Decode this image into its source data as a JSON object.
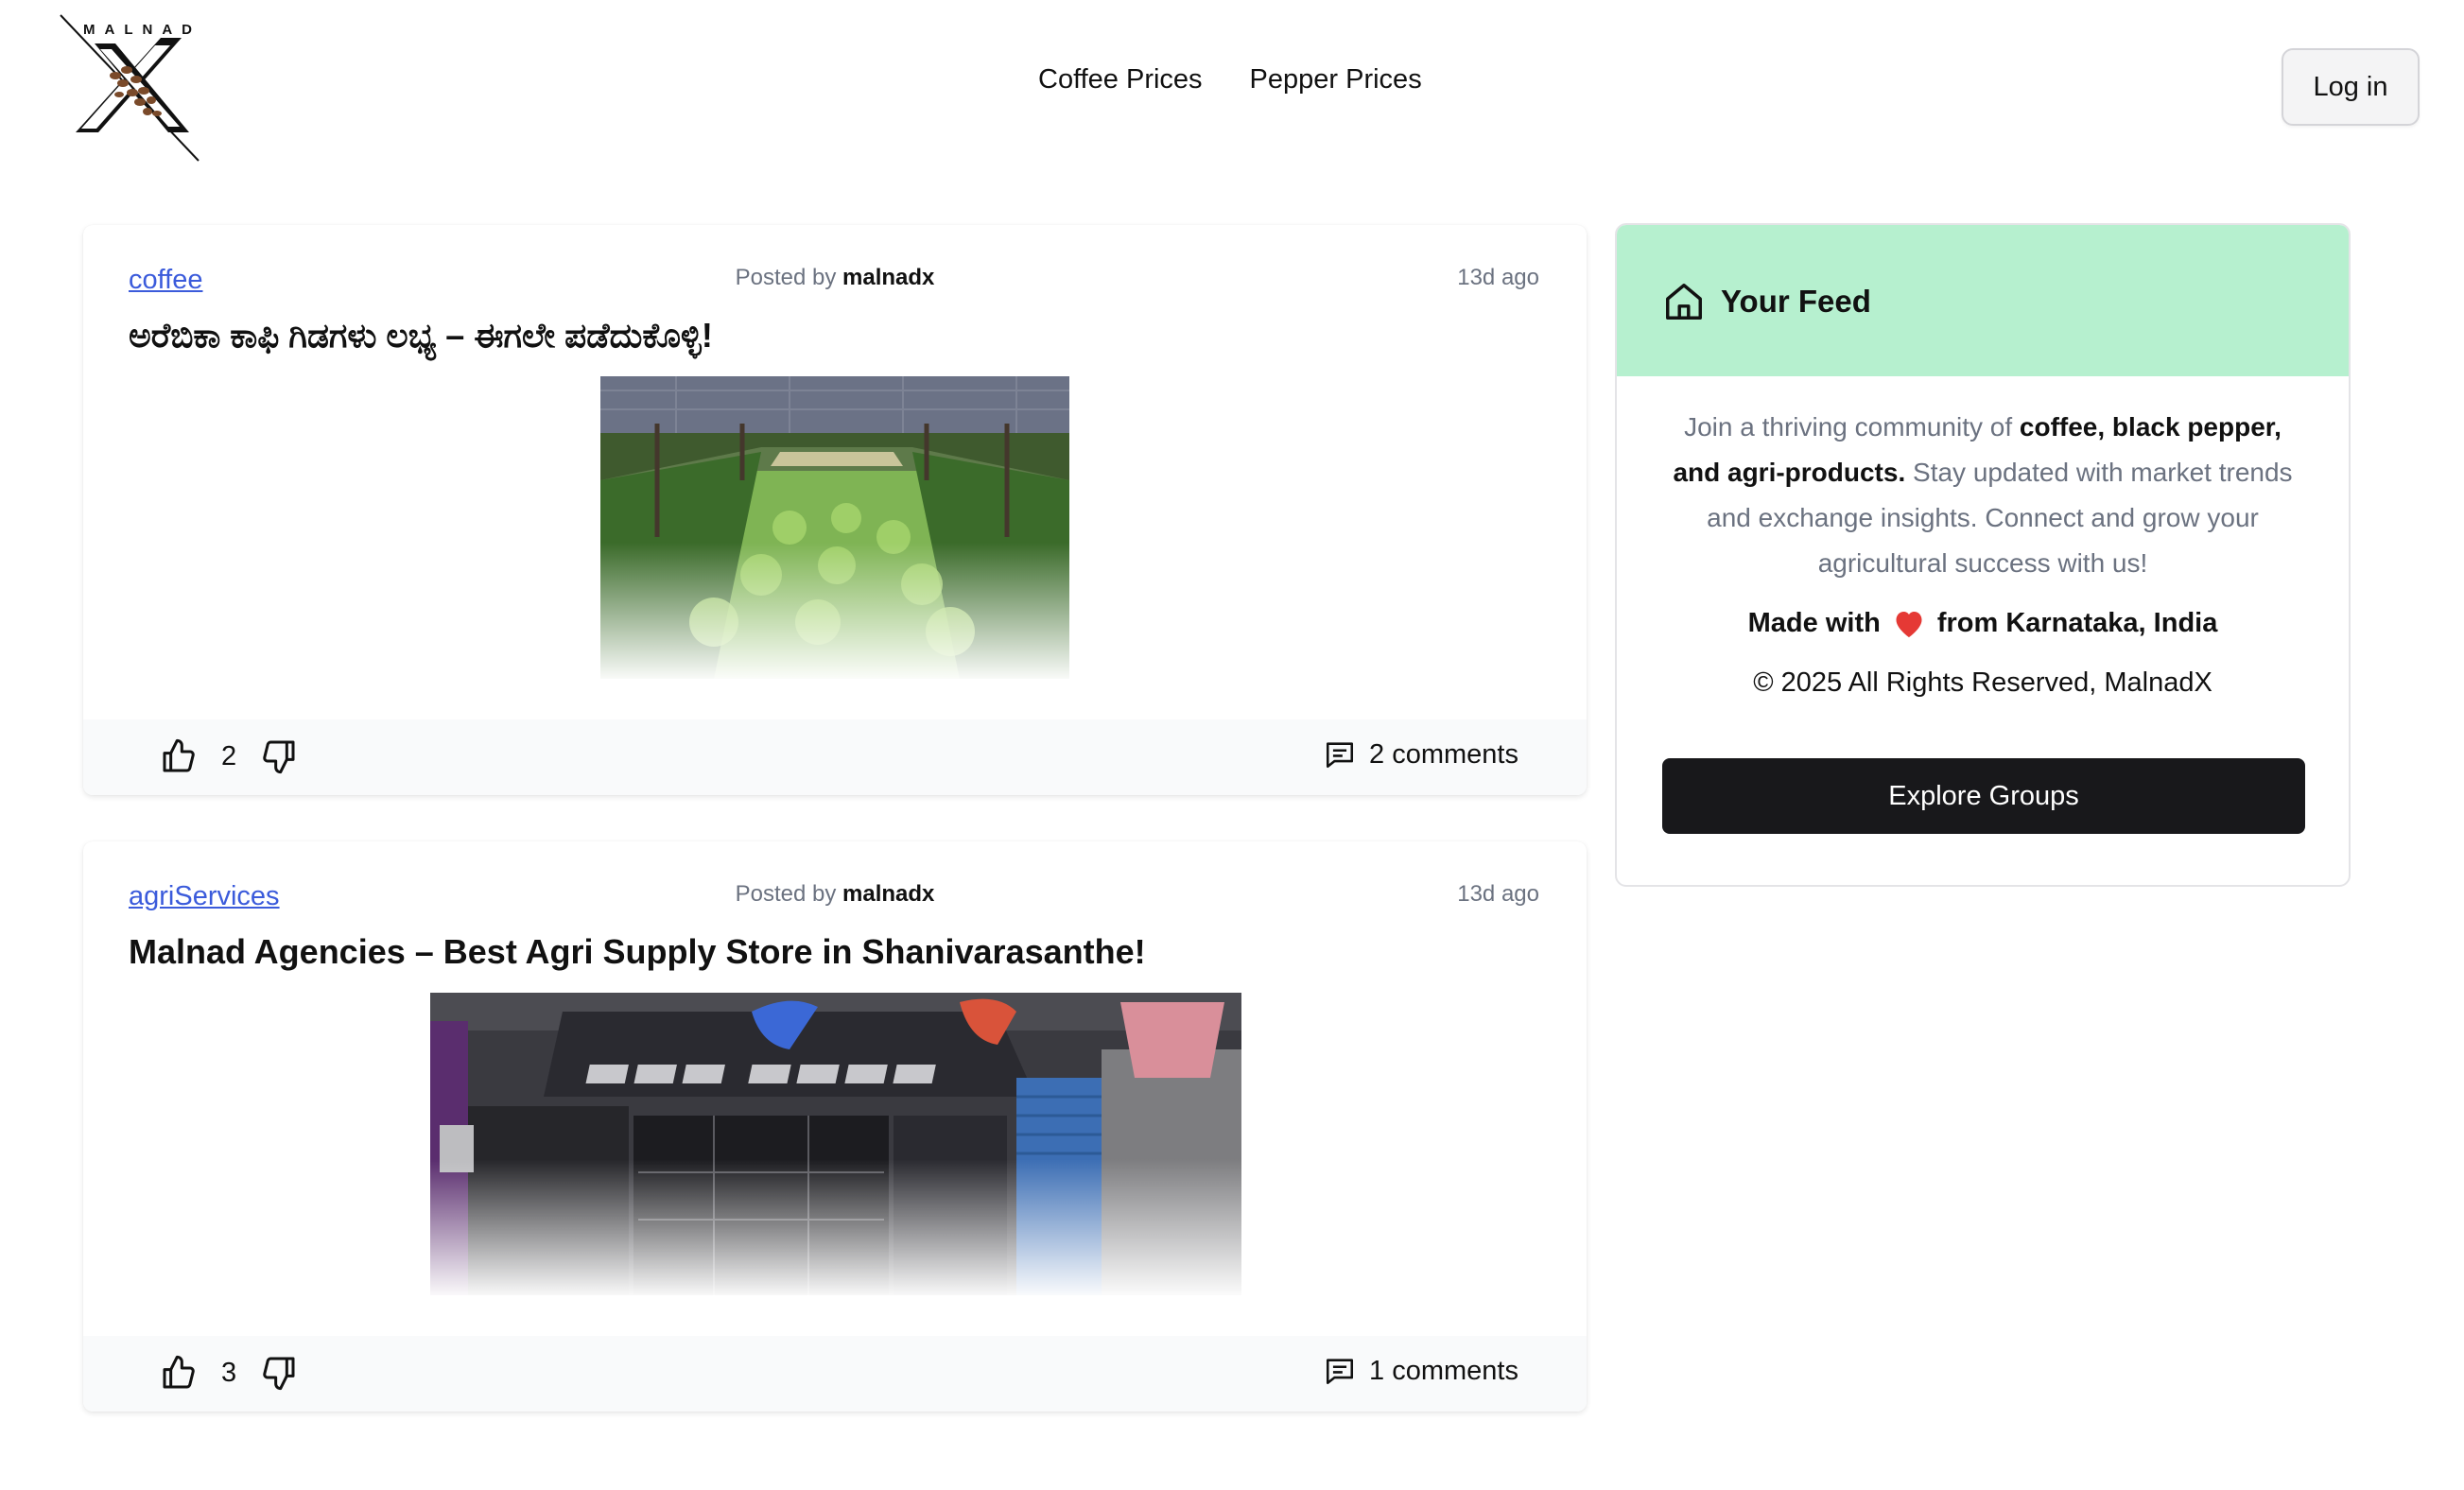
{
  "header": {
    "logo_text": "MALNAD",
    "nav": [
      "Coffee Prices",
      "Pepper Prices"
    ],
    "login_label": "Log in"
  },
  "posts": [
    {
      "group": "coffee",
      "posted_by_label": "Posted by",
      "author": "malnadx",
      "time_ago": "13d ago",
      "title": "ಅರೆಬಿಕಾ ಕಾಫಿ ಗಿಡಗಳು ಲಭ್ಯ – ಈಗಲೇ ಪಡೆದುಕೊಳ್ಳಿ!",
      "votes": "2",
      "comments": "2 comments"
    },
    {
      "group": "agriServices",
      "posted_by_label": "Posted by",
      "author": "malnadx",
      "time_ago": "13d ago",
      "title": "Malnad Agencies – Best Agri Supply Store in Shanivarasanthe!",
      "votes": "3",
      "comments": "1 comments"
    }
  ],
  "sidebar": {
    "title": "Your Feed",
    "desc_1": "Join a thriving community of ",
    "desc_bold_1": "coffee, black pepper, and agri-products.",
    "desc_2": " Stay updated with market trends and exchange insights. Connect and grow your agricultural success with us!",
    "made_with_1": "Made with",
    "made_with_2": "from Karnataka, India",
    "copyright": "© 2025 All Rights Reserved, MalnadX",
    "explore_label": "Explore Groups"
  },
  "colors": {
    "feed_header": "#b6f0cf",
    "link": "#3b5bdb",
    "button_dark": "#18181b",
    "heart": "#e53935"
  }
}
